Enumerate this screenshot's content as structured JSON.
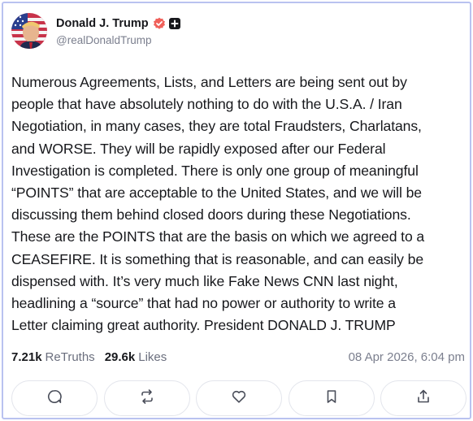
{
  "post": {
    "author": {
      "display_name": "Donald J. Trump",
      "handle": "@realDonaldTrump",
      "verified_icon": "verified-badge-icon",
      "plus_icon": "plus-badge-icon"
    },
    "lines": [
      "Numerous Agreements, Lists, and Letters are being sent out by",
      "people that have absolutely nothing to do with the U.S.A. / Iran",
      "Negotiation, in many cases, they are total Fraudsters, Charlatans,",
      "and WORSE. They will be rapidly exposed after our Federal",
      "Investigation is completed. There is only one group of meaningful",
      "“POINTS” that are acceptable to the United States, and we will be",
      "discussing them behind closed doors during these Negotiations.",
      "These are the POINTS that are the basis on which we agreed to a",
      "CEASEFIRE. It is something that is reasonable, and can easily be",
      "dispensed with. It’s very much like Fake News CNN last night,",
      "headlining a “source” that had no power or authority to write a",
      "Letter claiming great authority. President DONALD J. TRUMP"
    ],
    "stats": {
      "retruths_count": "7.21k",
      "retruths_label": "ReTruths",
      "likes_count": "29.6k",
      "likes_label": "Likes",
      "timestamp": "08 Apr 2026, 6:04 pm"
    },
    "actions": [
      {
        "name": "reply-button",
        "icon": "comment-icon"
      },
      {
        "name": "retruth-button",
        "icon": "repost-icon"
      },
      {
        "name": "like-button",
        "icon": "heart-icon"
      },
      {
        "name": "bookmark-button",
        "icon": "bookmark-icon"
      },
      {
        "name": "share-button",
        "icon": "share-icon"
      }
    ]
  },
  "colors": {
    "verified": "#f0605a",
    "border": "#b9c2f0",
    "text": "#17181c",
    "muted": "#7b7f8e"
  }
}
